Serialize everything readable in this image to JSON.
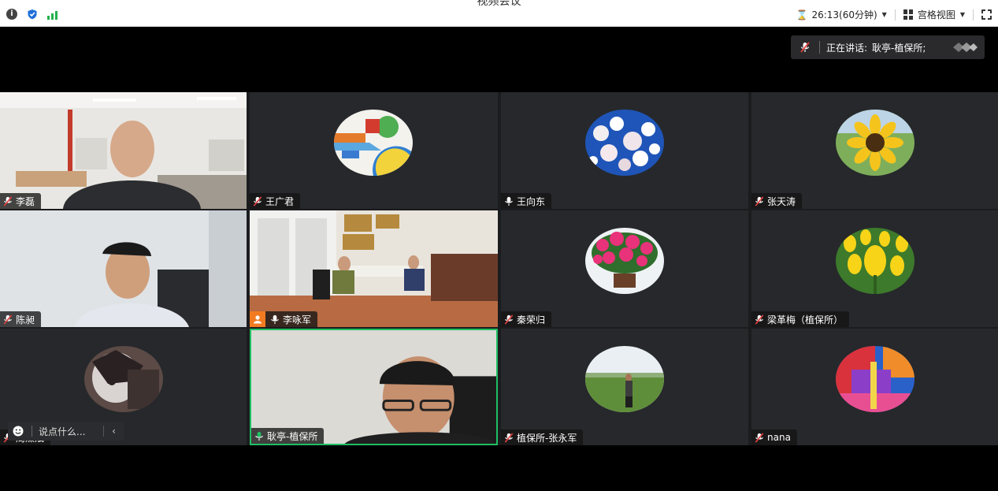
{
  "window": {
    "title": "视频会议"
  },
  "topbar": {
    "timer": "26:13(60分钟)",
    "view_label": "宫格视图"
  },
  "speaking": {
    "label": "正在讲话:",
    "name": "耿亭-植保所;"
  },
  "chat": {
    "placeholder": "说点什么..."
  },
  "participants": [
    {
      "name": "李磊",
      "mic": "muted",
      "type": "video"
    },
    {
      "name": "王广君",
      "mic": "muted",
      "type": "avatar",
      "avatar": "abstract"
    },
    {
      "name": "王向东",
      "mic": "on",
      "type": "avatar",
      "avatar": "blossom"
    },
    {
      "name": "张天涛",
      "mic": "muted",
      "type": "avatar",
      "avatar": "sunflower"
    },
    {
      "name": "陈昶",
      "mic": "muted",
      "type": "video"
    },
    {
      "name": "李咏军",
      "mic": "on",
      "type": "video",
      "host": true
    },
    {
      "name": "秦荣归",
      "mic": "muted",
      "type": "avatar",
      "avatar": "azalea"
    },
    {
      "name": "梁革梅（植保所）",
      "mic": "muted",
      "type": "avatar",
      "avatar": "tulips"
    },
    {
      "name": "周燥斌",
      "mic": "muted",
      "type": "avatar",
      "avatar": "dark"
    },
    {
      "name": "耿亭-植保所",
      "mic": "on",
      "type": "video",
      "active": true
    },
    {
      "name": "植保所-张永军",
      "mic": "muted",
      "type": "avatar",
      "avatar": "field"
    },
    {
      "name": "nana",
      "mic": "muted",
      "type": "avatar",
      "avatar": "painting"
    }
  ],
  "colors": {
    "accent_green": "#1fbf63",
    "host_orange": "#f27b21",
    "tile_bg": "#26282b"
  }
}
